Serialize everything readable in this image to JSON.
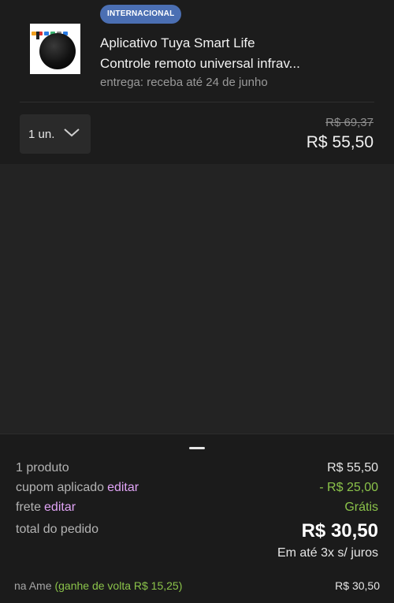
{
  "product": {
    "badge": "INTERNACIONAL",
    "title_line1": "Aplicativo Tuya Smart Life",
    "title_line2": "Controle remoto universal infrav...",
    "delivery": "entrega: receba até 24 de junho",
    "quantity": "1 un.",
    "old_price": "R$ 69,37",
    "price": "R$ 55,50"
  },
  "summary": {
    "products_label": "1 produto",
    "products_value": "R$ 55,50",
    "coupon_label": "cupom aplicado",
    "coupon_edit": "editar",
    "coupon_value": "- R$ 25,00",
    "shipping_label": "frete",
    "shipping_edit": "editar",
    "shipping_value": "Grátis",
    "total_label": "total do pedido",
    "total_value": "R$ 30,50",
    "installments": "Em até 3x s/ juros",
    "ame_label": "na Ame",
    "ame_cashback": "(ganhe de volta R$ 15,25)",
    "ame_value": "R$ 30,50"
  },
  "colors": {
    "badge": "#4b6fb3",
    "edit_link": "#e1a4f6",
    "green": "#8bc34a"
  },
  "icons": [
    "chevron-down-icon",
    "product-thumbnail",
    "drag-handle-icon"
  ]
}
